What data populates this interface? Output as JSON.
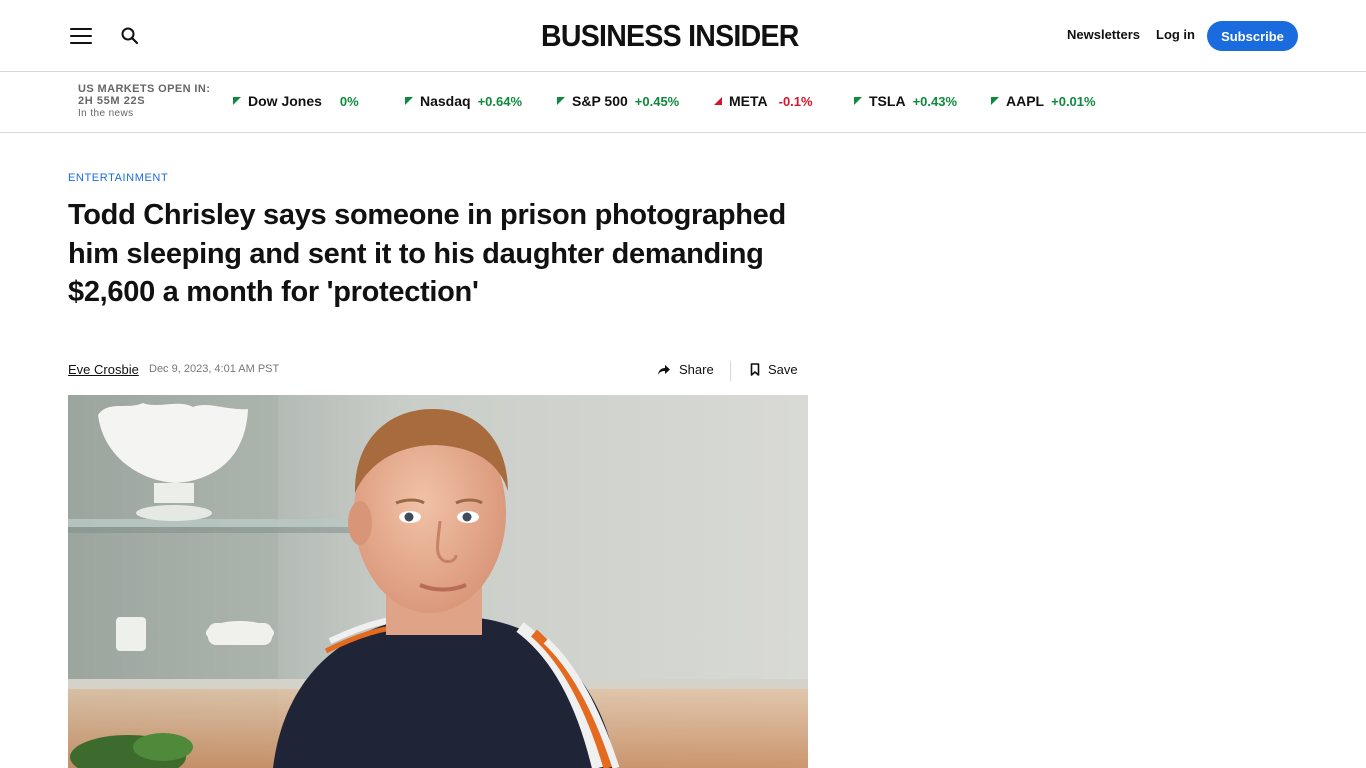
{
  "header": {
    "logo": "BUSINESS INSIDER",
    "newsletters": "Newsletters",
    "login": "Log in",
    "subscribe": "Subscribe"
  },
  "market": {
    "status_line1": "US MARKETS OPEN IN:",
    "status_line2": "2H 55M 22S",
    "status_line3": "In the news",
    "tickers": [
      {
        "name": "Dow Jones",
        "change": "0%",
        "direction": "up"
      },
      {
        "name": "Nasdaq",
        "change": "+0.64%",
        "direction": "up"
      },
      {
        "name": "S&P 500",
        "change": "+0.45%",
        "direction": "up"
      },
      {
        "name": "META",
        "change": "-0.1%",
        "direction": "down"
      },
      {
        "name": "TSLA",
        "change": "+0.43%",
        "direction": "up"
      },
      {
        "name": "AAPL",
        "change": "+0.01%",
        "direction": "up"
      }
    ]
  },
  "article": {
    "category": "ENTERTAINMENT",
    "headline": "Todd Chrisley says someone in prison photographed him sleeping and sent it to his daughter demanding $2,600 a month for 'protection'",
    "author": "Eve Crosbie",
    "date": "Dec 9, 2023, 4:01 AM PST",
    "share": "Share",
    "save": "Save"
  },
  "colors": {
    "accent": "#1a6cde",
    "positive": "#0e8a3d",
    "negative": "#d6152b"
  }
}
